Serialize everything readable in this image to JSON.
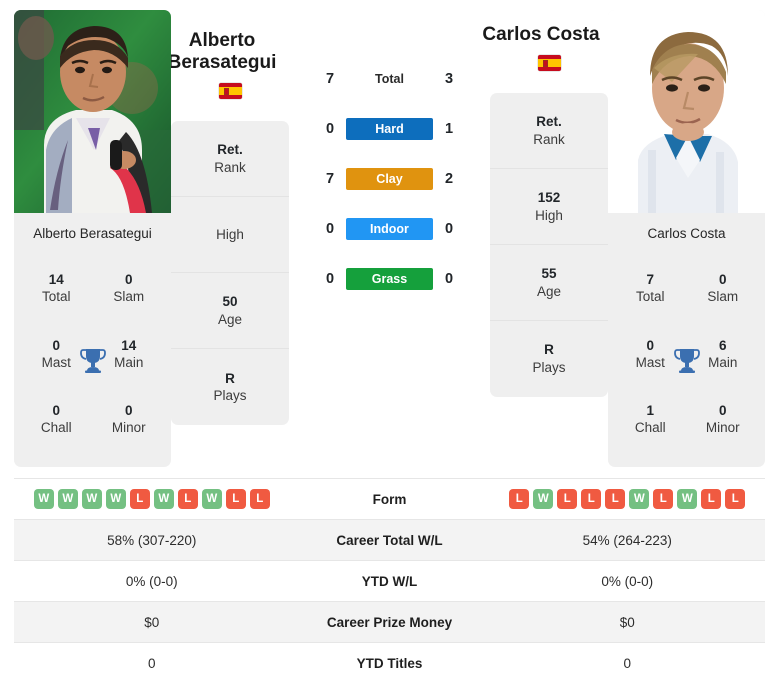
{
  "players": {
    "left": {
      "name": "Alberto Berasategui",
      "name_line1": "Alberto",
      "name_line2": "Berasategui",
      "country_flag": "spain-flag",
      "card_name": "Alberto Berasategui",
      "rank_value": "Ret.",
      "rank_label": "Rank",
      "high_value": "",
      "high_label": "High",
      "age_value": "50",
      "age_label": "Age",
      "plays_value": "R",
      "plays_label": "Plays",
      "titles": {
        "total_value": "14",
        "total_label": "Total",
        "slam_value": "0",
        "slam_label": "Slam",
        "mast_value": "0",
        "mast_label": "Mast",
        "main_value": "14",
        "main_label": "Main",
        "chall_value": "0",
        "chall_label": "Chall",
        "minor_value": "0",
        "minor_label": "Minor"
      },
      "h2h": {
        "total": "7",
        "hard": "0",
        "clay": "7",
        "indoor": "0",
        "grass": "0"
      },
      "form": [
        "W",
        "W",
        "W",
        "W",
        "L",
        "W",
        "L",
        "W",
        "L",
        "L"
      ],
      "career_total_wl": "58% (307-220)",
      "ytd_wl": "0% (0-0)",
      "career_prize_money": "$0",
      "ytd_titles": "0"
    },
    "right": {
      "name": "Carlos Costa",
      "name_line1": "Carlos Costa",
      "name_line2": "",
      "country_flag": "spain-flag",
      "card_name": "Carlos Costa",
      "rank_value": "Ret.",
      "rank_label": "Rank",
      "high_value": "152",
      "high_label": "High",
      "age_value": "55",
      "age_label": "Age",
      "plays_value": "R",
      "plays_label": "Plays",
      "titles": {
        "total_value": "7",
        "total_label": "Total",
        "slam_value": "0",
        "slam_label": "Slam",
        "mast_value": "0",
        "mast_label": "Mast",
        "main_value": "6",
        "main_label": "Main",
        "chall_value": "1",
        "chall_label": "Chall",
        "minor_value": "0",
        "minor_label": "Minor"
      },
      "h2h": {
        "total": "3",
        "hard": "1",
        "clay": "2",
        "indoor": "0",
        "grass": "0"
      },
      "form": [
        "L",
        "W",
        "L",
        "L",
        "L",
        "W",
        "L",
        "W",
        "L",
        "L"
      ],
      "career_total_wl": "54% (264-223)",
      "ytd_wl": "0% (0-0)",
      "career_prize_money": "$0",
      "ytd_titles": "0"
    }
  },
  "surfaces": {
    "total_label": "Total",
    "hard_label": "Hard",
    "clay_label": "Clay",
    "indoor_label": "Indoor",
    "grass_label": "Grass",
    "colors": {
      "hard": "#0d6ebd",
      "clay": "#e0930f",
      "indoor": "#2196f3",
      "grass": "#15a03c"
    }
  },
  "table": {
    "form_label": "Form",
    "career_total_wl_label": "Career Total W/L",
    "ytd_wl_label": "YTD W/L",
    "career_prize_money_label": "Career Prize Money",
    "ytd_titles_label": "YTD Titles"
  },
  "colors": {
    "win_badge": "#74c082",
    "loss_badge": "#f05a41",
    "card_bg": "#efefef",
    "trophy": "#3b6fb0"
  }
}
